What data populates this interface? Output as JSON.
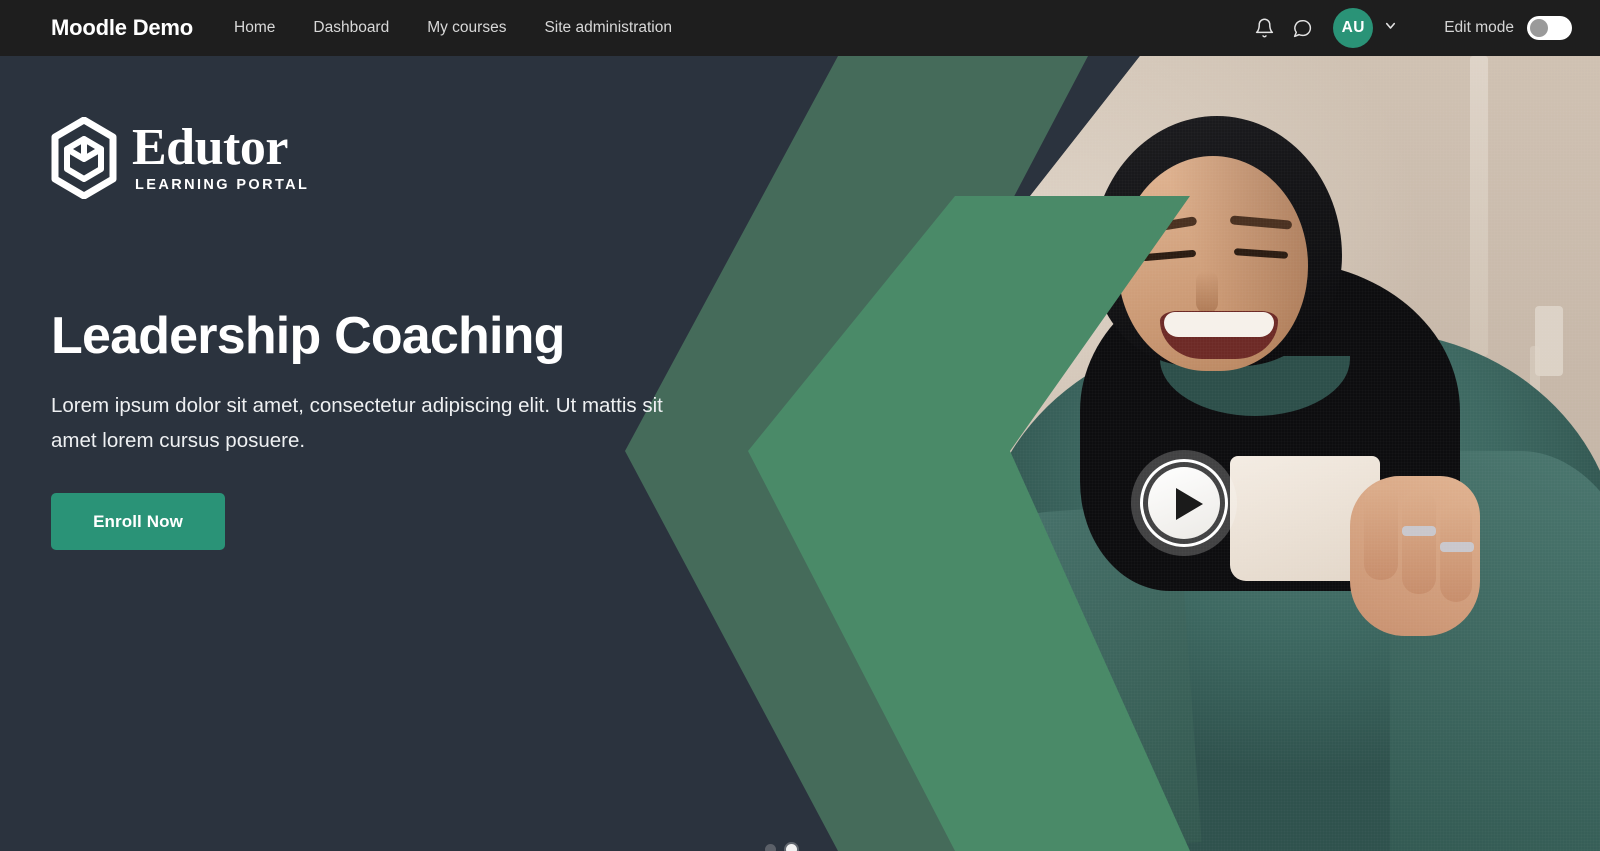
{
  "navbar": {
    "brand": "Moodle Demo",
    "links": [
      {
        "label": "Home"
      },
      {
        "label": "Dashboard"
      },
      {
        "label": "My courses"
      },
      {
        "label": "Site administration"
      }
    ],
    "notifications_icon": "bell-icon",
    "messages_icon": "message-bubble-icon",
    "avatar_initials": "AU",
    "avatar_color": "#2a9377",
    "caret_icon": "chevron-down-icon",
    "edit_mode_label": "Edit mode",
    "edit_mode_state": "off",
    "background_color": "#1e1e1e"
  },
  "hero": {
    "background_color": "#2b333e",
    "logo": {
      "mark_icon": "hexagon-cube-logo-icon",
      "word": "Edutor",
      "tagline": "LEARNING PORTAL"
    },
    "title": "Leadership Coaching",
    "description": "Lorem ipsum dolor sit amet, consectetur adipiscing elit. Ut mattis sit amet lorem cursus posuere.",
    "cta_label": "Enroll Now",
    "cta_color": "#2a9377",
    "chevron_dark_color": "#456b5a",
    "chevron_light_color": "#4a8a68",
    "play_button_icon": "play-icon",
    "carousel": {
      "dots": [
        {
          "state": "inactive"
        },
        {
          "state": "active"
        }
      ]
    },
    "photo_alt": "Smiling woman in black hijab and green sweatshirt holding a mug at a desk with a laptop"
  }
}
